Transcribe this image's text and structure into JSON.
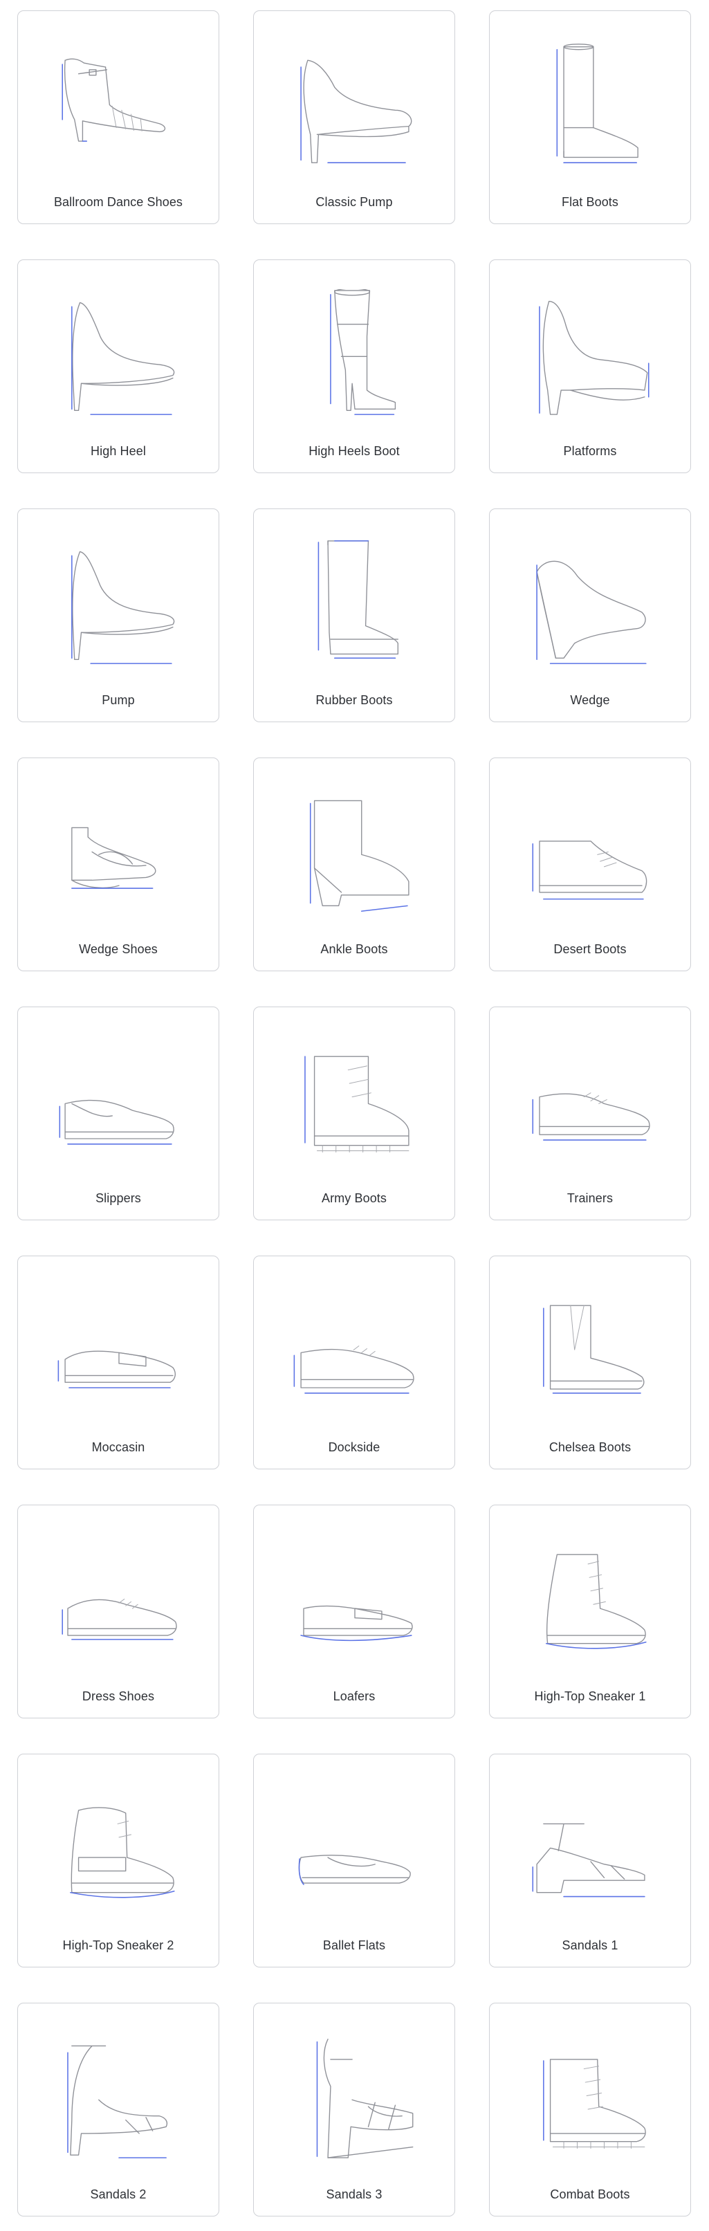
{
  "catalog": {
    "items": [
      {
        "label": "Ballroom Dance Shoes",
        "icon": "ballroom-dance-shoe-icon"
      },
      {
        "label": "Classic Pump",
        "icon": "classic-pump-icon"
      },
      {
        "label": "Flat Boots",
        "icon": "flat-boots-icon"
      },
      {
        "label": "High Heel",
        "icon": "high-heel-icon"
      },
      {
        "label": "High Heels Boot",
        "icon": "high-heels-boot-icon"
      },
      {
        "label": "Platforms",
        "icon": "platforms-icon"
      },
      {
        "label": "Pump",
        "icon": "pump-icon"
      },
      {
        "label": "Rubber Boots",
        "icon": "rubber-boots-icon"
      },
      {
        "label": "Wedge",
        "icon": "wedge-icon"
      },
      {
        "label": "Wedge Shoes",
        "icon": "wedge-shoes-icon"
      },
      {
        "label": "Ankle Boots",
        "icon": "ankle-boots-icon"
      },
      {
        "label": "Desert Boots",
        "icon": "desert-boots-icon"
      },
      {
        "label": "Slippers",
        "icon": "slippers-icon"
      },
      {
        "label": "Army Boots",
        "icon": "army-boots-icon"
      },
      {
        "label": "Trainers",
        "icon": "trainers-icon"
      },
      {
        "label": "Moccasin",
        "icon": "moccasin-icon"
      },
      {
        "label": "Dockside",
        "icon": "dockside-icon"
      },
      {
        "label": "Chelsea Boots",
        "icon": "chelsea-boots-icon"
      },
      {
        "label": "Dress Shoes",
        "icon": "dress-shoes-icon"
      },
      {
        "label": "Loafers",
        "icon": "loafers-icon"
      },
      {
        "label": "High-Top Sneaker 1",
        "icon": "high-top-sneaker-1-icon"
      },
      {
        "label": "High-Top Sneaker 2",
        "icon": "high-top-sneaker-2-icon"
      },
      {
        "label": "Ballet Flats",
        "icon": "ballet-flats-icon"
      },
      {
        "label": "Sandals 1",
        "icon": "sandals-1-icon"
      },
      {
        "label": "Sandals 2",
        "icon": "sandals-2-icon"
      },
      {
        "label": "Sandals 3",
        "icon": "sandals-3-icon"
      },
      {
        "label": "Combat Boots",
        "icon": "combat-boots-icon"
      }
    ]
  },
  "colors": {
    "card_border": "#cfd1d6",
    "outline": "#8e9097",
    "measure_accent": "#5b73e6",
    "label_text": "#2e3136"
  }
}
